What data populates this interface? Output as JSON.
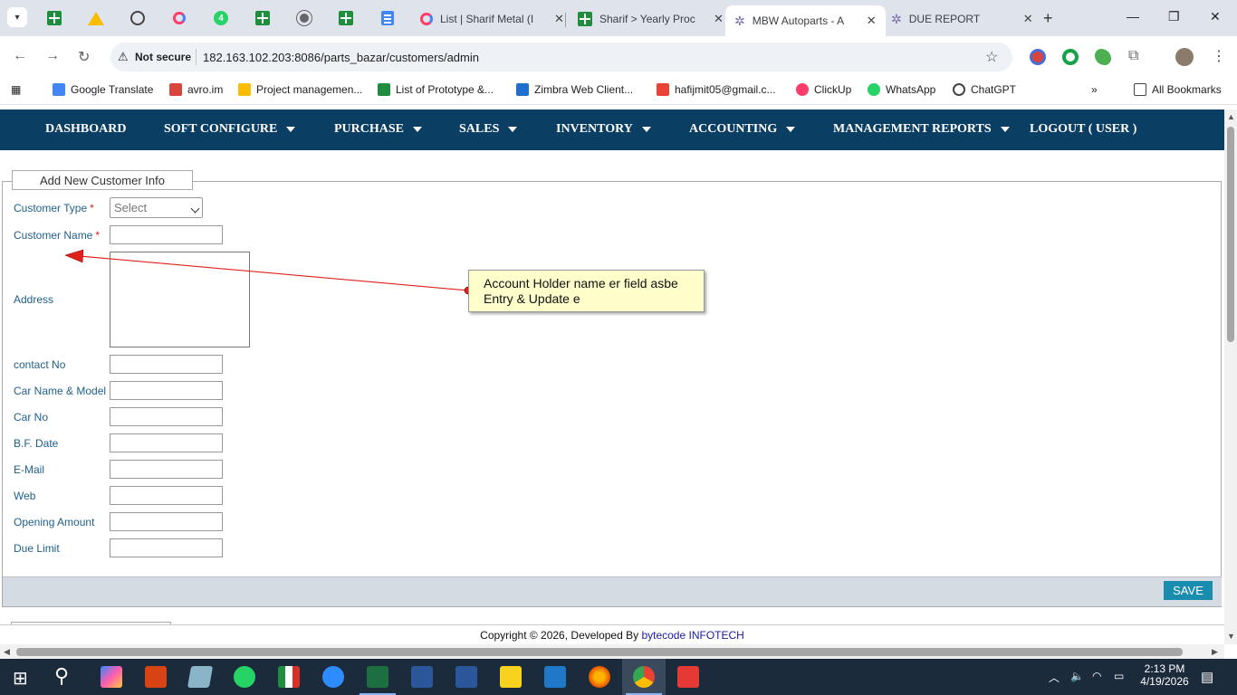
{
  "browser": {
    "tabs": [
      {
        "title": "List | Sharif Metal (I",
        "active": false
      },
      {
        "title": "Sharif > Yearly Proc",
        "active": false
      },
      {
        "title": "MBW Autoparts - A",
        "active": true
      },
      {
        "title": "DUE REPORT",
        "active": false
      }
    ],
    "close_glyph": "✕",
    "new_tab_glyph": "+",
    "security_label": "Not secure",
    "url": "182.163.102.203:8086/parts_bazar/customers/admin",
    "bookmarks": [
      "Google Translate",
      "avro.im",
      "Project managemen...",
      "List of Prototype &...",
      "Zimbra Web Client...",
      "hafijmit05@gmail.c...",
      "ClickUp",
      "WhatsApp",
      "ChatGPT"
    ],
    "all_bookmarks": "All Bookmarks",
    "pinned_badge": "4"
  },
  "nav": {
    "items": [
      {
        "label": "DASHBOARD",
        "dropdown": false
      },
      {
        "label": "SOFT CONFIGURE",
        "dropdown": true
      },
      {
        "label": "PURCHASE",
        "dropdown": true
      },
      {
        "label": "SALES",
        "dropdown": true
      },
      {
        "label": "INVENTORY",
        "dropdown": true
      },
      {
        "label": "ACCOUNTING",
        "dropdown": true
      },
      {
        "label": "MANAGEMENT REPORTS",
        "dropdown": true
      },
      {
        "label": "LOGOUT ( USER )",
        "dropdown": false
      }
    ]
  },
  "form": {
    "legend": "Add New Customer Info",
    "customer_type_label": "Customer Type",
    "customer_type_value": "Select",
    "required_mark": "*",
    "customer_name_label": "Customer Name",
    "address_label": "Address",
    "contact_label": "contact No",
    "car_model_label": "Car Name & Model",
    "car_no_label": "Car No",
    "bf_date_label": "B.F. Date",
    "email_label": "E-Mail",
    "web_label": "Web",
    "opening_amount_label": "Opening Amount",
    "due_limit_label": "Due Limit",
    "save_label": "SAVE"
  },
  "annotation": {
    "line1": "Account Holder name er field asbe",
    "line2": "Entry & Update e",
    "color": "#e0201a"
  },
  "footer": {
    "copyright": "Copyright © 2026, Developed By ",
    "brand": "bytecode INFOTECH"
  },
  "taskbar": {
    "time": "2:13 PM",
    "date": "4/19/2026"
  },
  "colors": {
    "nav_bg": "#0b3e63",
    "label": "#1f5f8b",
    "save_bg": "#1a8cad"
  }
}
